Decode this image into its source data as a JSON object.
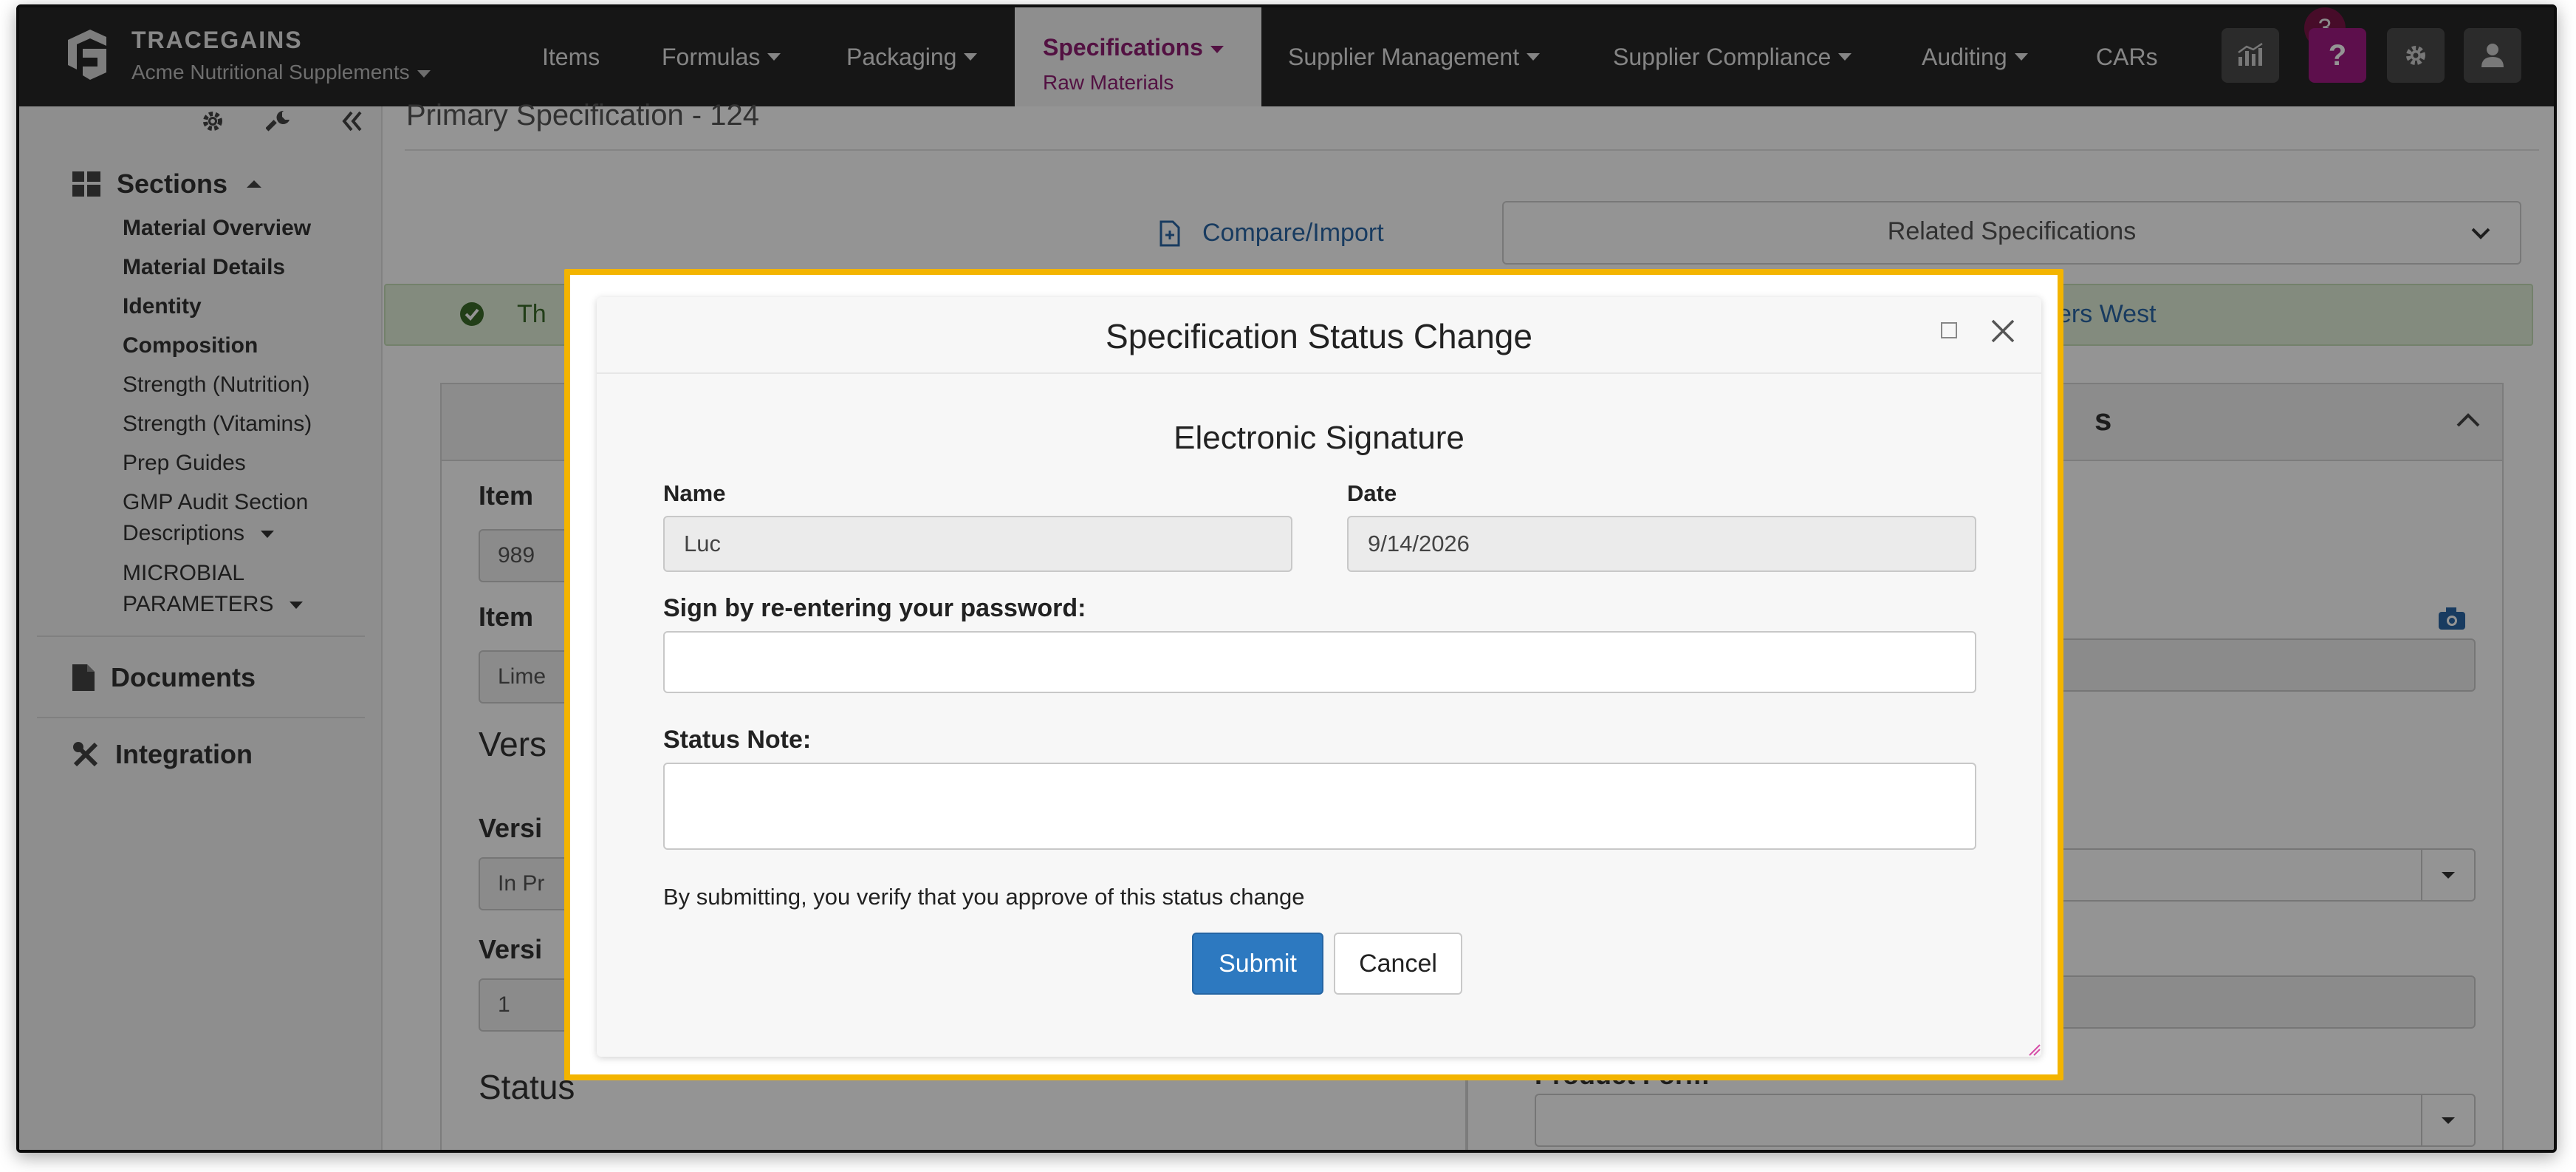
{
  "brand": {
    "name": "TRACEGAINS",
    "org": "Acme Nutritional Supplements"
  },
  "nav": {
    "items": [
      "Items",
      "Formulas",
      "Packaging",
      "Specifications",
      "Supplier Management",
      "Supplier Compliance",
      "Auditing",
      "CARs"
    ],
    "active_label": "Specifications",
    "active_sublabel": "Raw Materials",
    "notification_count": "3",
    "help_label": "?"
  },
  "sidebar": {
    "sections_label": "Sections",
    "items": [
      "Material Overview",
      "Material Details",
      "Identity",
      "Composition",
      "Strength (Nutrition)",
      "Strength (Vitamins)",
      "Prep Guides",
      "GMP Audit Section",
      "Descriptions",
      "MICROBIAL",
      "PARAMETERS"
    ],
    "documents_label": "Documents",
    "integration_label": "Integration"
  },
  "main": {
    "page_title": "Primary Specification - 124",
    "compare_label": "Compare/Import",
    "related_label": "Related Specifications",
    "alert_start": "Th",
    "alert_end": "ilders West",
    "right_panel_title_fragment": "s",
    "left_fields": {
      "item_label_1": "Item",
      "item_value_1": "989",
      "item_label_2": "Item",
      "item_value_2": "Lime",
      "version_heading": "Vers",
      "version_label_1": "Versi",
      "version_value_1": "In Pr",
      "version_label_2": "Versi",
      "version_value_2": "1",
      "status_heading": "Status"
    },
    "right_fields": {
      "product_form_label": "Product Form"
    }
  },
  "modal": {
    "title": "Specification Status Change",
    "subtitle": "Electronic Signature",
    "name_label": "Name",
    "name_value": "Luc",
    "date_label": "Date",
    "date_value": "9/14/2026",
    "password_label": "Sign by re-entering your password:",
    "password_value": "",
    "note_label": "Status Note:",
    "note_value": "",
    "verify_text": "By submitting, you verify that you approve of this status change",
    "submit_label": "Submit",
    "cancel_label": "Cancel"
  },
  "colors": {
    "nav_bg": "#262626",
    "brand_accent": "#8f1e73",
    "help_button": "#a01a83",
    "primary_button": "#2d79c0",
    "focus_frame": "#f3b400",
    "alert_bg": "#e2efda"
  }
}
